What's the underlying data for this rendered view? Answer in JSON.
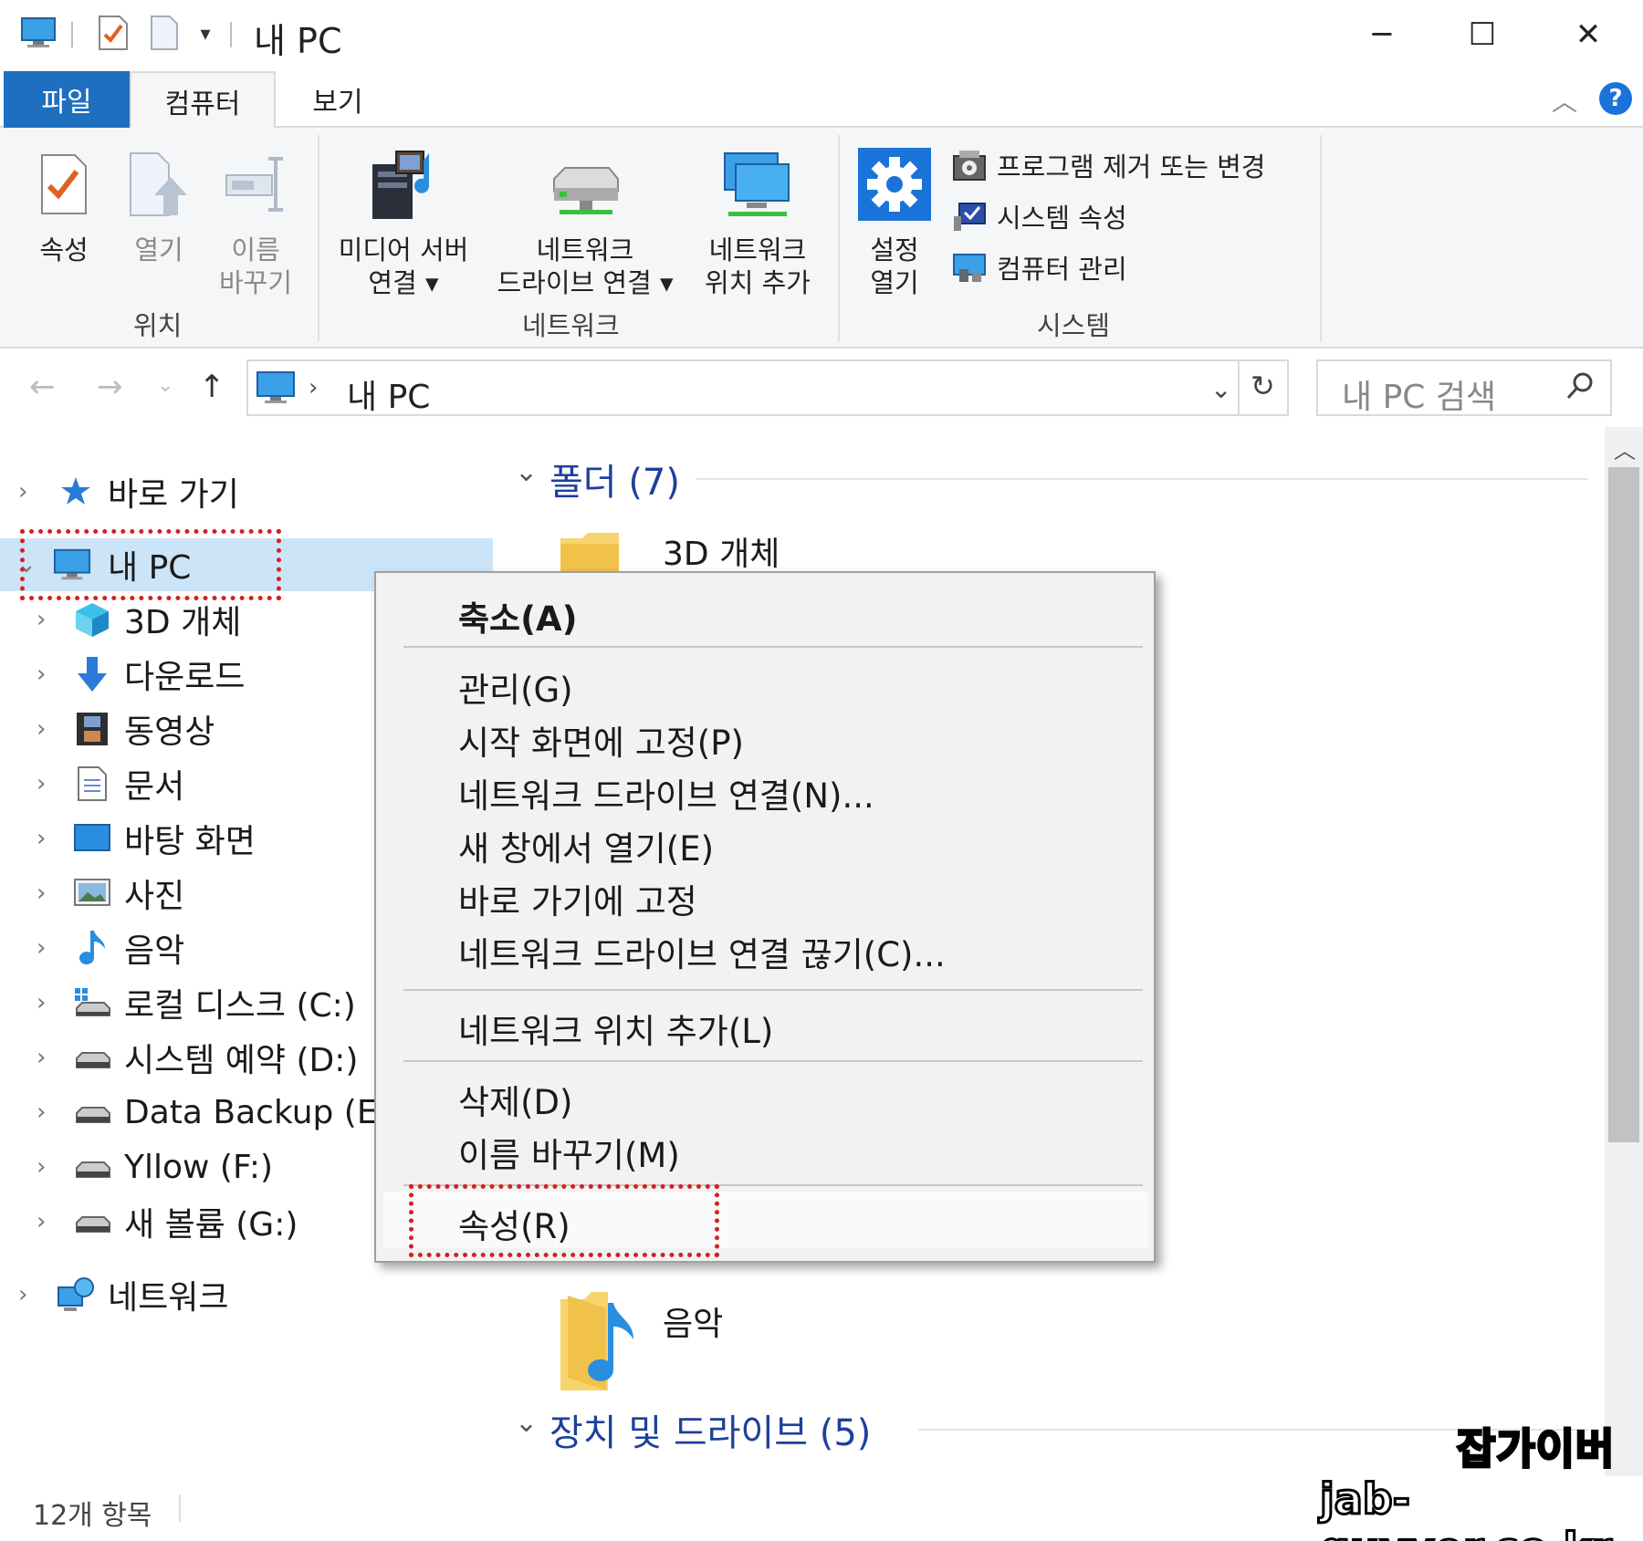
{
  "window": {
    "title": "내 PC",
    "minimize": "─",
    "maximize": "☐",
    "close": "✕"
  },
  "tabs": {
    "file": "파일",
    "computer": "컴퓨터",
    "view": "보기"
  },
  "ribbon": {
    "location": {
      "properties": "속성",
      "open": "열기",
      "rename_line1": "이름",
      "rename_line2": "바꾸기",
      "group": "위치"
    },
    "network": {
      "media_line1": "미디어 서버",
      "media_line2": "연결",
      "map_line1": "네트워크",
      "map_line2": "드라이브 연결",
      "add_line1": "네트워크",
      "add_line2": "위치 추가",
      "group": "네트워크"
    },
    "system": {
      "settings_line1": "설정",
      "settings_line2": "열기",
      "uninstall": "프로그램 제거 또는 변경",
      "sysprops": "시스템 속성",
      "manage": "컴퓨터 관리",
      "group": "시스템"
    }
  },
  "address": {
    "path": "내 PC",
    "search_placeholder": "내 PC 검색"
  },
  "nav": {
    "quick_access": "바로 가기",
    "this_pc": "내 PC",
    "items": [
      {
        "label": "3D 개체",
        "icon": "cube-3d-icon"
      },
      {
        "label": "다운로드",
        "icon": "download-arrow-icon"
      },
      {
        "label": "동영상",
        "icon": "video-film-icon"
      },
      {
        "label": "문서",
        "icon": "document-icon"
      },
      {
        "label": "바탕 화면",
        "icon": "desktop-icon"
      },
      {
        "label": "사진",
        "icon": "picture-icon"
      },
      {
        "label": "음악",
        "icon": "music-note-icon"
      },
      {
        "label": "로컬 디스크 (C:)",
        "icon": "windows-drive-icon"
      },
      {
        "label": "시스템 예약 (D:)",
        "icon": "drive-icon"
      },
      {
        "label": "Data Backup (E:)",
        "icon": "drive-icon"
      },
      {
        "label": "Yllow (F:)",
        "icon": "drive-icon"
      },
      {
        "label": "새 볼륨 (G:)",
        "icon": "drive-icon"
      }
    ],
    "network": "네트워크"
  },
  "content": {
    "folders_header": "폴더 (7)",
    "folder_3d": "3D 개체",
    "folder_music": "음악",
    "devices_header": "장치 및 드라이브 (5)"
  },
  "context_menu": {
    "collapse": "축소(A)",
    "manage": "관리(G)",
    "pin_start": "시작 화면에 고정(P)",
    "map_drive": "네트워크 드라이브 연결(N)...",
    "open_new": "새 창에서 열기(E)",
    "pin_quick": "바로 가기에 고정",
    "disconnect": "네트워크 드라이브 연결 끊기(C)...",
    "add_location": "네트워크 위치 추가(L)",
    "delete": "삭제(D)",
    "rename": "이름 바꾸기(M)",
    "properties": "속성(R)"
  },
  "status": {
    "count": "12개 항목"
  },
  "watermark": {
    "line1": "잡가이버",
    "line2": "jab-guyver.co.kr"
  },
  "colors": {
    "accent": "#1e6fc0",
    "selection": "#cce4f7",
    "highlight_box": "#d81e1e",
    "section_header": "#1e3f9c"
  }
}
